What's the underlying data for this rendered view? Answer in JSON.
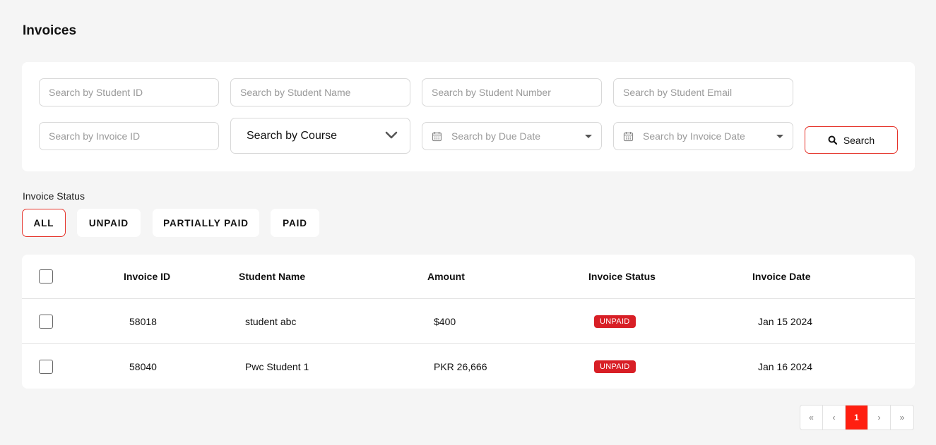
{
  "page": {
    "title": "Invoices"
  },
  "filters": {
    "student_id_placeholder": "Search by Student ID",
    "student_name_placeholder": "Search by Student Name",
    "student_number_placeholder": "Search by Student Number",
    "student_email_placeholder": "Search by Student Email",
    "invoice_id_placeholder": "Search by Invoice ID",
    "course_label": "Search by Course",
    "due_date_label": "Search by Due Date",
    "invoice_date_label": "Search by Invoice Date",
    "search_button": "Search"
  },
  "status": {
    "label": "Invoice Status",
    "chips": [
      "ALL",
      "UNPAID",
      "PARTIALLY PAID",
      "PAID"
    ],
    "active": "ALL"
  },
  "table": {
    "columns": [
      "Invoice ID",
      "Student Name",
      "Amount",
      "Invoice Status",
      "Invoice Date"
    ],
    "rows": [
      {
        "invoice_id": "58018",
        "student_name": "student abc",
        "amount": "$400",
        "status": "UNPAID",
        "date": "Jan 15 2024"
      },
      {
        "invoice_id": "58040",
        "student_name": "Pwc Student 1",
        "amount": "PKR 26,666",
        "status": "UNPAID",
        "date": "Jan 16 2024"
      }
    ]
  },
  "pagination": {
    "first": "«",
    "prev": "‹",
    "current": "1",
    "next": "›",
    "last": "»"
  },
  "colors": {
    "accent": "#e5332a",
    "badge": "#d81f26",
    "active_page": "#ff1f10"
  }
}
